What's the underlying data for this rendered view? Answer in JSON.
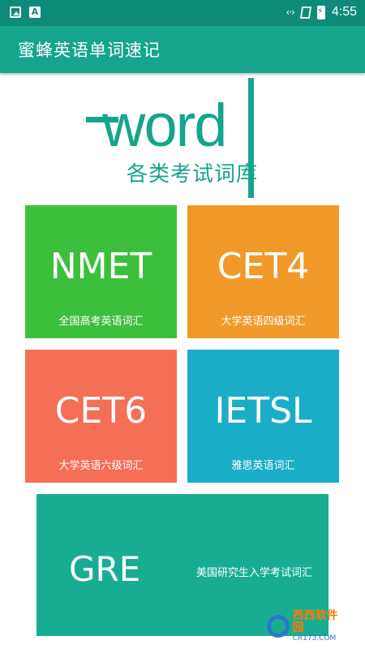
{
  "status_bar": {
    "time": "4:55",
    "icons": [
      "image-icon",
      "text-a-icon",
      "signal-icon",
      "sim-icon",
      "battery-charging-icon"
    ]
  },
  "app_bar": {
    "title": "蜜蜂英语单词速记"
  },
  "logo": {
    "word": "word",
    "subtitle": "各类考试词库"
  },
  "tiles": [
    {
      "name": "NMET",
      "desc": "全国高考英语词汇",
      "color": "#3dbf3e"
    },
    {
      "name": "CET4",
      "desc": "大学英语四级词汇",
      "color": "#f19a2a"
    },
    {
      "name": "CET6",
      "desc": "大学英语六级词汇",
      "color": "#f56e56"
    },
    {
      "name": "IETSL",
      "desc": "雅思英语词汇",
      "color": "#1aadc8"
    },
    {
      "name": "GRE",
      "desc": "美国研究生入学考试词汇",
      "color": "#18ad92"
    }
  ],
  "colors": {
    "status_bar": "#0e8a78",
    "app_bar": "#15a58d",
    "logo": "#15a58d"
  },
  "watermark": {
    "name": "西西软件园",
    "url": "CR173.COM"
  }
}
